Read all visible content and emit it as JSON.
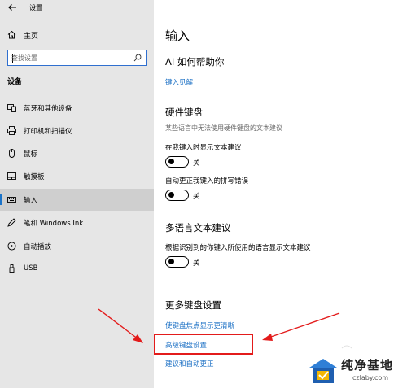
{
  "window": {
    "title": "设置"
  },
  "sidebar": {
    "home": "主页",
    "search_placeholder": "查找设置",
    "section": "设备",
    "items": [
      {
        "label": "蓝牙和其他设备",
        "icon": "bluetooth-device-icon"
      },
      {
        "label": "打印机和扫描仪",
        "icon": "printer-icon"
      },
      {
        "label": "鼠标",
        "icon": "mouse-icon"
      },
      {
        "label": "触摸板",
        "icon": "touchpad-icon"
      },
      {
        "label": "输入",
        "icon": "keyboard-icon",
        "selected": true
      },
      {
        "label": "笔和 Windows Ink",
        "icon": "pen-icon"
      },
      {
        "label": "自动播放",
        "icon": "autoplay-icon"
      },
      {
        "label": "USB",
        "icon": "usb-icon"
      }
    ]
  },
  "main": {
    "title": "输入",
    "ai": {
      "heading": "AI 如何帮助你",
      "link": "键入见解"
    },
    "hardware_keyboard": {
      "heading": "硬件键盘",
      "description": "某些语言中无法使用硬件键盘的文本建议",
      "settings": [
        {
          "label": "在我键入时显示文本建议",
          "state": "关"
        },
        {
          "label": "自动更正我键入的拼写错误",
          "state": "关"
        }
      ]
    },
    "multilingual": {
      "heading": "多语言文本建议",
      "label": "根据识别到的你键入所使用的语言显示文本建议",
      "state": "关"
    },
    "more": {
      "heading": "更多键盘设置",
      "links": [
        "使键盘焦点显示更清晰",
        "高级键盘设置",
        "建议和自动更正"
      ]
    }
  },
  "watermark": {
    "text": "纯净基地",
    "sub": "czlaby.com"
  },
  "colors": {
    "accent": "#1a6fc4",
    "annotation": "#e31b1b",
    "sidebar_bg": "#e6e6e6"
  }
}
